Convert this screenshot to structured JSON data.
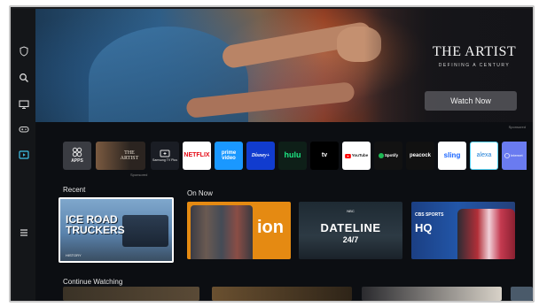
{
  "hero": {
    "title": "THE ARTIST",
    "subtitle": "DEFINING A CENTURY",
    "watch_button": "Watch Now",
    "sponsored": "Sponsored"
  },
  "nav": [
    {
      "icon": "shield-icon"
    },
    {
      "icon": "search-icon"
    },
    {
      "icon": "monitor-icon"
    },
    {
      "icon": "gamepad-icon"
    },
    {
      "icon": "media-icon",
      "active": true
    },
    {
      "icon": "menu-icon"
    }
  ],
  "apps": {
    "apps_label": "APPS",
    "artist_tile": "THE ARTIST",
    "artist_sub": "Sponsored",
    "samsung_tv_plus": "Samsung TV Plus",
    "netflix": "NETFLIX",
    "prime": "prime video",
    "disney": "Disney+",
    "hulu": "hulu",
    "appletv": "tv",
    "youtube": "YouTube",
    "spotify": "Spotify",
    "peacock": "peacock",
    "sling": "sling",
    "alexa": "alexa",
    "internet": "Internet"
  },
  "sections": {
    "recent": "Recent",
    "on_now": "On Now",
    "continue_watching": "Continue Watching"
  },
  "recent": {
    "title": "ICE ROAD TRUCKERS",
    "badge": "HISTORY"
  },
  "on_now": [
    {
      "name": "ion",
      "label": "ion"
    },
    {
      "name": "dateline",
      "label": "DATELINE",
      "sub": "24/7",
      "network": "NBC"
    },
    {
      "name": "cbs-sports-hq",
      "label": "CBS SPORTS",
      "sub": "HQ"
    }
  ],
  "colors": {
    "accent": "#3fc1e6",
    "netflix": "#e50914",
    "prime": "#1a98ff",
    "disney": "#113ccf",
    "youtube": "#ff0000",
    "spotify": "#1db954",
    "ion": "#e58a12"
  }
}
